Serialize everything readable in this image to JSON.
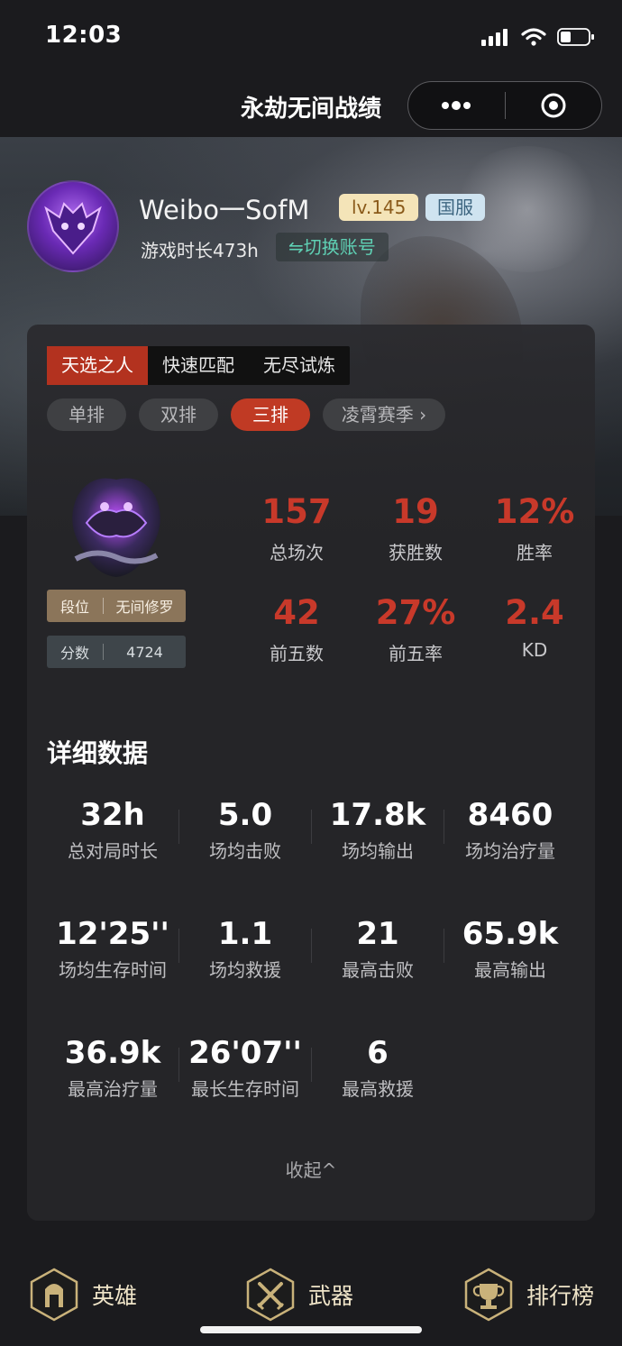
{
  "status_bar": {
    "time": "12:03"
  },
  "nav": {
    "title": "永劫无间战绩",
    "more_icon": "more-dots-icon",
    "close_icon": "target-close-icon"
  },
  "profile": {
    "username": "Weibo一SofM",
    "level": "lv.145",
    "server": "国服",
    "playtime": "游戏时长473h",
    "switch_account": "⇋切换账号"
  },
  "mode_tabs": [
    "天选之人",
    "快速匹配",
    "无尽试炼"
  ],
  "sub_tabs": [
    "单排",
    "双排",
    "三排",
    "凌霄赛季 ›"
  ],
  "rank": {
    "tier_label": "段位",
    "tier_value": "无间修罗",
    "score_label": "分数",
    "score_value": "4724"
  },
  "summary": [
    {
      "value": "157",
      "label": "总场次"
    },
    {
      "value": "19",
      "label": "获胜数"
    },
    {
      "value": "12%",
      "label": "胜率"
    },
    {
      "value": "42",
      "label": "前五数"
    },
    {
      "value": "27%",
      "label": "前五率"
    },
    {
      "value": "2.4",
      "label": "KD"
    }
  ],
  "details": {
    "title": "详细数据",
    "items": [
      {
        "value": "32h",
        "label": "总对局时长"
      },
      {
        "value": "5.0",
        "label": "场均击败"
      },
      {
        "value": "17.8k",
        "label": "场均输出"
      },
      {
        "value": "8460",
        "label": "场均治疗量"
      },
      {
        "value": "12'25''",
        "label": "场均生存时间"
      },
      {
        "value": "1.1",
        "label": "场均救援"
      },
      {
        "value": "21",
        "label": "最高击败"
      },
      {
        "value": "65.9k",
        "label": "最高输出"
      },
      {
        "value": "36.9k",
        "label": "最高治疗量"
      },
      {
        "value": "26'07''",
        "label": "最长生存时间"
      },
      {
        "value": "6",
        "label": "最高救援"
      }
    ],
    "collapse": "收起^"
  },
  "bottom_nav": [
    {
      "label": "英雄",
      "icon": "hero-helmet-icon"
    },
    {
      "label": "武器",
      "icon": "crossed-swords-icon"
    },
    {
      "label": "排行榜",
      "icon": "trophy-icon"
    }
  ],
  "colors": {
    "accent_red": "#c8392a",
    "active_tab": "#b3321f",
    "teal": "#5fd0b4",
    "gold": "#efe4c8"
  }
}
